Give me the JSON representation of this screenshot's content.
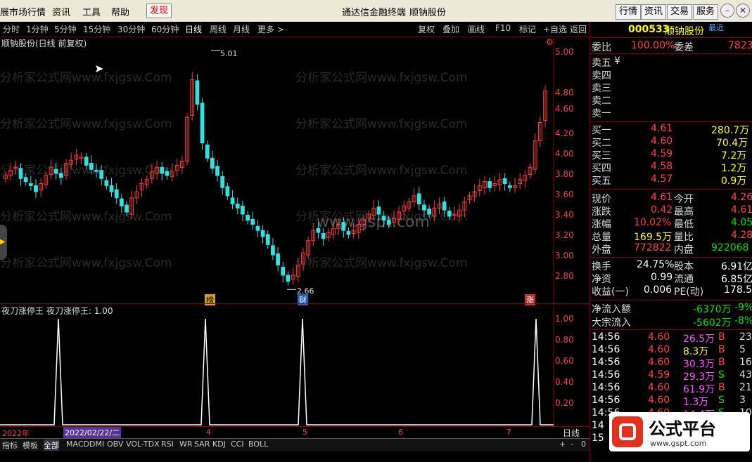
{
  "menubar": {
    "items": [
      "展市场行情",
      "资讯",
      "工具",
      "帮助",
      "发现"
    ],
    "center_title": "通达信金融终端",
    "center_stock": "顺钠股份",
    "right_buttons": [
      "行情",
      "资讯",
      "交易",
      "服务"
    ]
  },
  "periods": {
    "items": [
      "分时",
      "1分钟",
      "5分钟",
      "15分钟",
      "30分钟",
      "60分钟",
      "日线",
      "周线",
      "月线",
      "更多 >"
    ],
    "selected": "日线",
    "tools": [
      "复权",
      "叠加",
      "画线",
      "F10",
      "标记",
      "+自选",
      "返回"
    ]
  },
  "kchart": {
    "title": "顺钠股份(日线 前复权)",
    "high_label": "5.01",
    "low_label": "2.66",
    "y_ticks": [
      "5.00",
      "4.80",
      "4.60",
      "4.40",
      "4.20",
      "4.00",
      "3.80",
      "3.60",
      "3.40",
      "3.20",
      "3.00",
      "2.80"
    ],
    "markers": [
      "榜",
      "财",
      "涨"
    ],
    "watermark": "分析家公式网www.fxjgsw.Com",
    "watermark2": "www.gspt.com"
  },
  "indicator": {
    "title": "夜刀涨停王",
    "label": "夜刀涨停王: 1.00",
    "y_ticks": [
      "1.00",
      "0.80",
      "0.60",
      "0.40",
      "0.20"
    ]
  },
  "datebar": {
    "items": [
      "2022年",
      "2022/02/22/二",
      "4",
      "5",
      "6",
      "7"
    ],
    "period": "日线",
    "right": [
      "+",
      "-",
      "0"
    ]
  },
  "tabs": [
    "指标",
    "模板",
    "全部",
    "MACD",
    "DMI",
    "OBV",
    "VOL-TDX",
    "RSI",
    "WR",
    "SAR",
    "KDJ",
    "CCI",
    "BOLL"
  ],
  "quote": {
    "code": "000533",
    "name": "顺钠股份",
    "recent": "最近",
    "weibi_label": "委比",
    "weibi": "100.00%",
    "weicha_label": "委差",
    "weicha": "7823",
    "asks": [
      [
        "卖五",
        "¥"
      ],
      [
        "卖四",
        ""
      ],
      [
        "卖三",
        ""
      ],
      [
        "卖二",
        ""
      ],
      [
        "卖一",
        ""
      ]
    ],
    "bids": [
      [
        "买一",
        "4.61",
        "280.7万"
      ],
      [
        "买二",
        "4.60",
        "70.4万"
      ],
      [
        "买三",
        "4.59",
        "7.2万"
      ],
      [
        "买四",
        "4.58",
        "1.2万"
      ],
      [
        "买五",
        "4.57",
        "0.9万"
      ]
    ],
    "stats": [
      [
        "现价",
        "4.61",
        "今开",
        "4.26"
      ],
      [
        "涨跌",
        "0.42",
        "最高",
        "4.61"
      ],
      [
        "涨幅",
        "10.02%",
        "最低",
        "4.05"
      ],
      [
        "总量",
        "169.5万",
        "量比",
        "4.28"
      ],
      [
        "外盘",
        "772822",
        "内盘",
        "922068"
      ]
    ],
    "stats2": [
      [
        "换手",
        "24.75%",
        "股本",
        "6.91亿"
      ],
      [
        "净资",
        "0.99",
        "流通",
        "6.85亿"
      ],
      [
        "收益(一)",
        "0.006",
        "PE(动)",
        "178.5"
      ]
    ],
    "flows": [
      [
        "净流入额",
        "-6370万",
        "-9%"
      ],
      [
        "大宗流入",
        "-5602万",
        "-8%"
      ]
    ],
    "ticks": [
      [
        "14:56",
        "4.60",
        "26.5万",
        "B",
        "23"
      ],
      [
        "14:56",
        "4.60",
        "8.3万",
        "B",
        "5"
      ],
      [
        "14:56",
        "4.60",
        "30.3万",
        "B",
        "16"
      ],
      [
        "14:56",
        "4.59",
        "29.3万",
        "S",
        "43"
      ],
      [
        "14:56",
        "4.60",
        "61.9万",
        "B",
        "21"
      ],
      [
        "14:56",
        "4.60",
        "1.3万",
        "S",
        "3"
      ],
      [
        "14:56",
        "4.60",
        "14.4万",
        "S",
        "10"
      ],
      [
        "14",
        "",
        "",
        " ",
        ""
      ],
      [
        "15",
        "",
        "",
        " ",
        ""
      ]
    ]
  },
  "logo": {
    "text": "公式平台",
    "url": "www.gspt.com"
  }
}
